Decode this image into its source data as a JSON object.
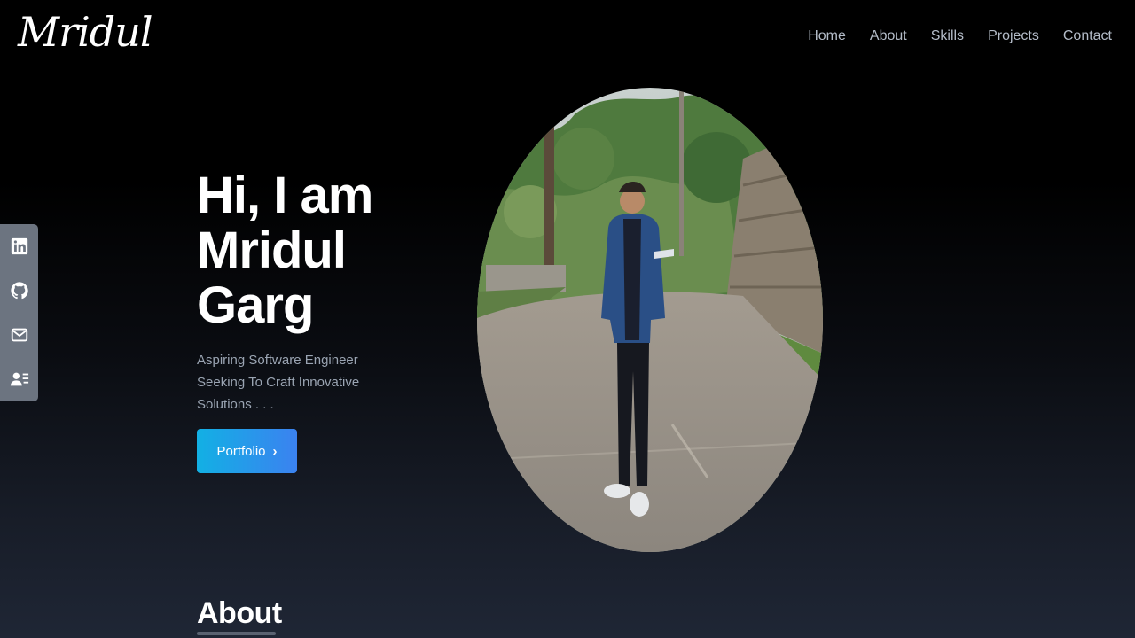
{
  "brand": {
    "logo_text": "Mridul"
  },
  "nav": {
    "home": "Home",
    "about": "About",
    "skills": "Skills",
    "projects": "Projects",
    "contact": "Contact"
  },
  "social": {
    "items": [
      {
        "icon": "linkedin-icon"
      },
      {
        "icon": "github-icon"
      },
      {
        "icon": "mail-icon"
      },
      {
        "icon": "resume-icon"
      }
    ]
  },
  "hero": {
    "line1": "Hi, I am",
    "line2": "Mridul",
    "line3": "Garg",
    "subtitle": "Aspiring Software Engineer Seeking To Craft Innovative Solutions . . .",
    "button_label": "Portfolio",
    "button_icon": "chevron-right-icon"
  },
  "about": {
    "title": "About"
  },
  "colors": {
    "accent_start": "#12b0e4",
    "accent_end": "#3b82f0",
    "nav_text": "#b4bcc8",
    "sidebar_bg": "#6c7480"
  }
}
